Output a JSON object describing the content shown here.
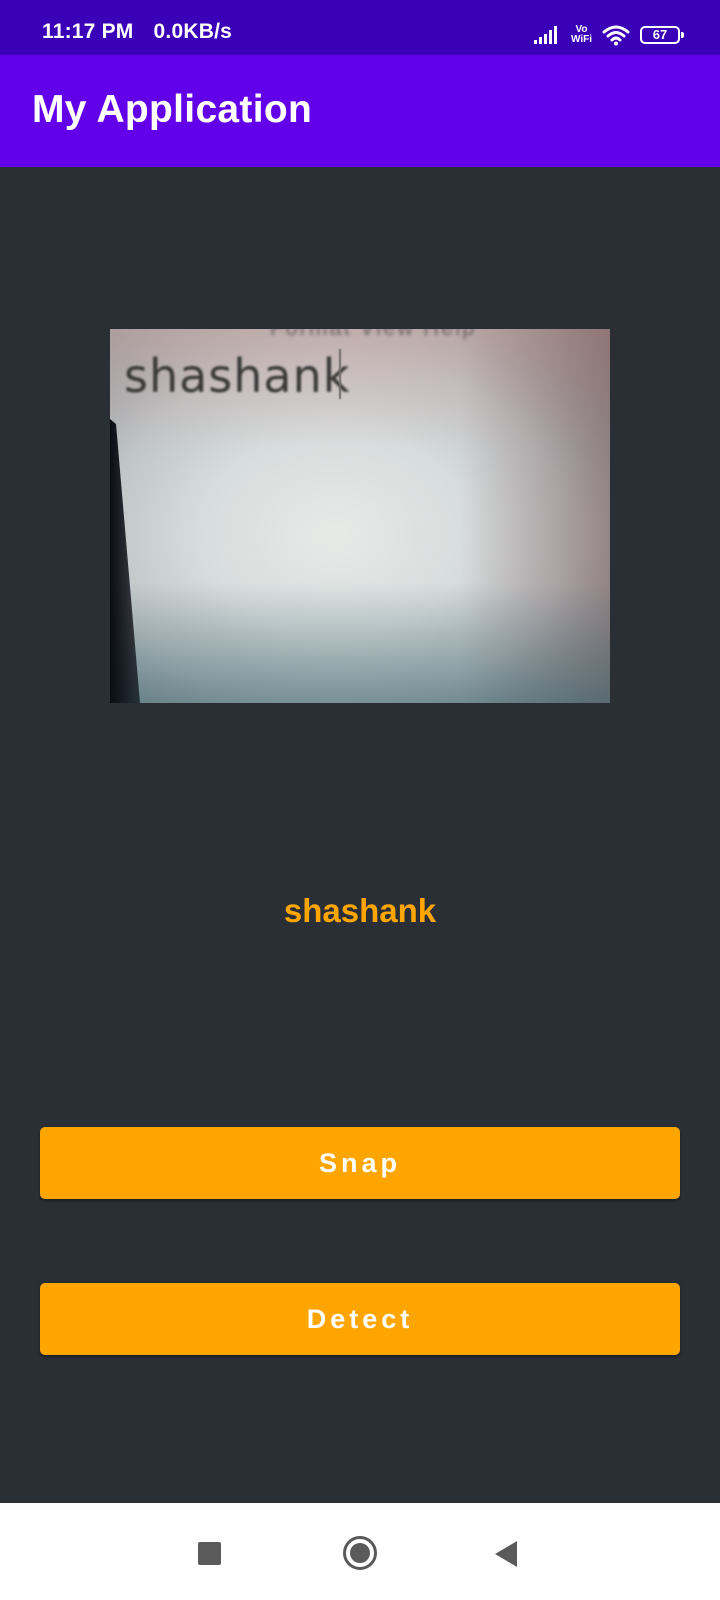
{
  "status_bar": {
    "time": "11:17 PM",
    "network_speed": "0.0KB/s",
    "icons": [
      "signal-icon",
      "vowifi-icon",
      "wifi-icon",
      "battery-icon"
    ],
    "vowifi_top": "Vo",
    "vowifi_bottom": "WiFi",
    "battery_level": "67"
  },
  "app_bar": {
    "title": "My Application"
  },
  "image_view": {
    "captured_text": "shashank",
    "menu_ghost_text": "Format  View  Help"
  },
  "result": {
    "text": "shashank"
  },
  "buttons": {
    "snap_label": "Snap",
    "detect_label": "Detect"
  },
  "nav_bar": {
    "icons": [
      "recents-icon",
      "home-icon",
      "back-icon"
    ]
  },
  "colors": {
    "status_bar": "#3a00b8",
    "app_bar": "#6200ea",
    "background": "#2a2f36",
    "accent": "#ffa500",
    "nav_bar": "#ffffff"
  }
}
